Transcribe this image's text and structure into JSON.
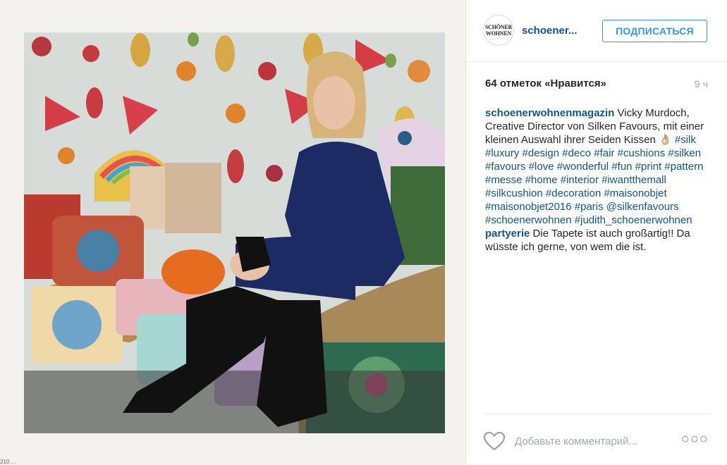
{
  "post": {
    "username": "schoener...",
    "follow_label": "ПОДПИСАТЬСЯ",
    "avatar_text_line1": "SCHÖNER",
    "avatar_text_line2": "WOHNEN",
    "likes": "64 отметок «Нравится»",
    "time": "9 ч"
  },
  "caption": {
    "user": "schoenerwohnenmagazin",
    "text": " Vicky Murdoch, Creative Director von Silken Favours, mit einer kleinen Auswahl ihrer Seiden Kissen 👌🏼 ",
    "hashtags": [
      "#silk",
      "#luxury",
      "#design",
      "#deco",
      "#fair",
      "#cushions",
      "#silken",
      "#favours",
      "#love",
      "#wonderful",
      "#fun",
      "#print",
      "#pattern",
      "#messe",
      "#home",
      "#interior",
      "#iwantthemall",
      "#silkcushion",
      "#decoration",
      "#maisonobjet",
      "#maisonobjet2016",
      "#paris",
      "@silkenfavours",
      "#schoenerwohnen",
      "#judith_schoenerwohnen"
    ]
  },
  "comment2": {
    "user": "partyerie",
    "text": " Die Tapete ist auch großartig!! Da wüsste ich gerne, von wem die ist."
  },
  "footer": {
    "placeholder": "Добавьте комментарий...",
    "more": "○○○"
  },
  "strip_text": "210 ... ",
  "colors": {
    "link": "#125688",
    "button": "#3897f0",
    "muted": "#a5a7aa"
  }
}
